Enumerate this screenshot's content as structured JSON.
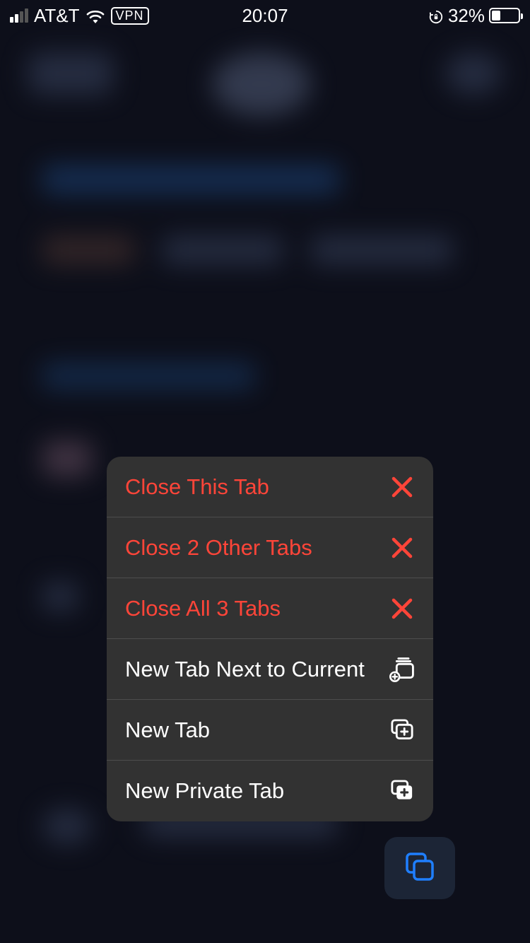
{
  "status_bar": {
    "carrier": "AT&T",
    "vpn": "VPN",
    "time": "20:07",
    "battery_pct": "32%"
  },
  "menu": {
    "items": [
      {
        "label": "Close This Tab"
      },
      {
        "label": "Close 2 Other Tabs"
      },
      {
        "label": "Close All 3 Tabs"
      },
      {
        "label": "New Tab Next to Current"
      },
      {
        "label": "New Tab"
      },
      {
        "label": "New Private Tab"
      }
    ]
  }
}
